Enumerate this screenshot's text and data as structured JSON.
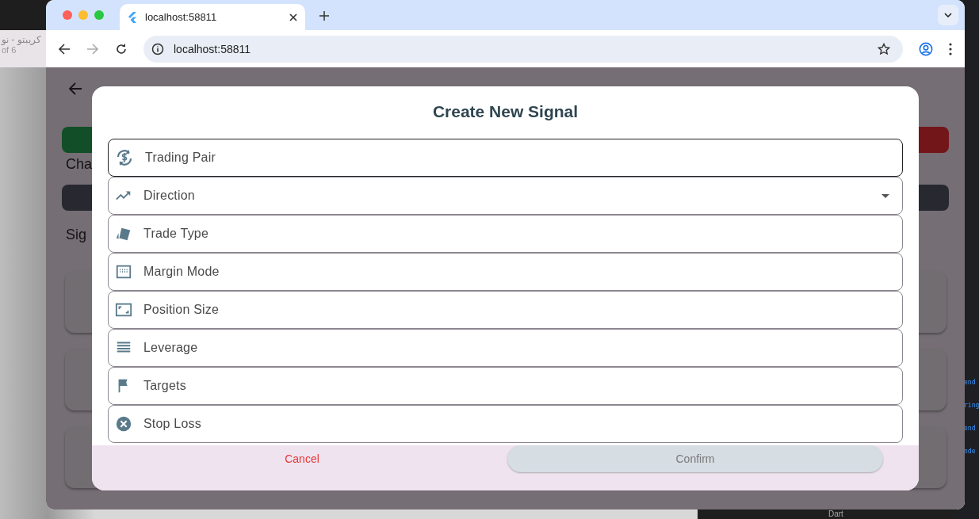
{
  "desktop": {
    "left_window": {
      "title": "كريبتو - نو",
      "subtitle": "of 6"
    },
    "editor": {
      "snippets": [
        "end",
        "ring",
        "end",
        "nde"
      ],
      "status": "Dart"
    }
  },
  "browser": {
    "tab": {
      "title": "localhost:58811"
    },
    "address": "localhost:58811"
  },
  "app": {
    "sections": [
      "Cha",
      "Sig"
    ]
  },
  "dialog": {
    "title": "Create New Signal",
    "fields": [
      {
        "label": "Trading Pair",
        "kind": "text",
        "focused": true
      },
      {
        "label": "Direction",
        "kind": "dropdown",
        "focused": false
      },
      {
        "label": "Trade Type",
        "kind": "text",
        "focused": false
      },
      {
        "label": "Margin Mode",
        "kind": "text",
        "focused": false
      },
      {
        "label": "Position Size",
        "kind": "text",
        "focused": false
      },
      {
        "label": "Leverage",
        "kind": "text",
        "focused": false
      },
      {
        "label": "Targets",
        "kind": "text",
        "focused": false
      },
      {
        "label": "Stop Loss",
        "kind": "text",
        "focused": false
      }
    ],
    "buttons": [
      {
        "label": "Cancel",
        "kind": "text",
        "disabled": false
      },
      {
        "label": "Confirm",
        "kind": "filled",
        "disabled": true
      }
    ]
  }
}
